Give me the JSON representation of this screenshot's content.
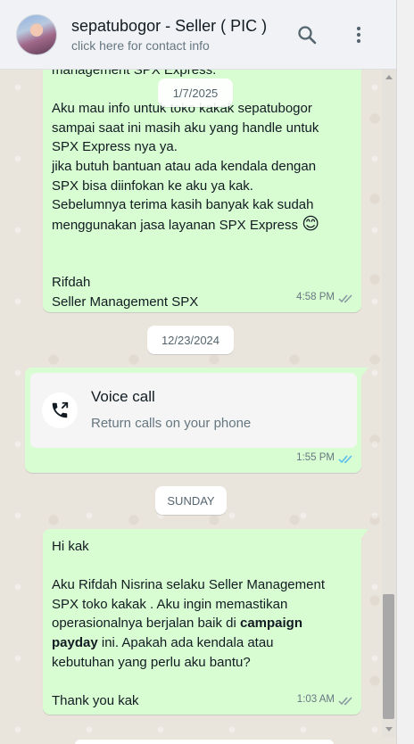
{
  "header": {
    "contact_name": "sepatubogor - Seller ( PIC )",
    "subtitle": "click here for contact info",
    "icons": [
      "search-icon",
      "more-vertical-icon"
    ]
  },
  "messages": {
    "first": {
      "partial_line": "management SPX Express.",
      "line_1": "Aku mau info untuk toko kakak sepatubogor",
      "line_2": "sampai saat ini masih aku yang handle untuk",
      "line_3": "SPX Express nya ya.",
      "line_4": "jika butuh bantuan atau ada kendala dengan",
      "line_5": "SPX bisa diinfokan ke aku ya kak.",
      "line_6": "Sebelumnya terima kasih banyak kak sudah",
      "line_7": "menggunakan jasa layanan SPX Express",
      "emoji": "😊",
      "sign_name": "Rifdah",
      "sign_title": "Seller Management SPX",
      "time": "4:58 PM",
      "status": "delivered"
    },
    "call": {
      "title": "Voice call",
      "subtitle": "Return calls on your phone",
      "time": "1:55 PM",
      "status": "read",
      "icon": "phone-outgoing-icon"
    },
    "last": {
      "greeting": "Hi kak",
      "body_1": "Aku Rifdah Nisrina selaku Seller Management",
      "body_2": "SPX toko kakak . Aku ingin memastikan",
      "body_3_pre": "operasionalnya berjalan baik di ",
      "body_3_bold": "campaign",
      "body_4_bold": "payday",
      "body_4_post": " ini. Apakah ada kendala atau",
      "body_5": "kebutuhan yang perlu aku bantu?",
      "closing": "Thank you kak",
      "time": "1:03 AM",
      "status": "delivered"
    }
  },
  "date_separators": {
    "floating": "1/7/2025",
    "mid": "12/23/2024",
    "sunday": "SUNDAY"
  },
  "colors": {
    "outgoing_bubble": "#d9fdd3",
    "chat_background": "#e9e4dc",
    "read_ticks": "#53bdeb",
    "delivered_ticks": "#8696a0"
  }
}
